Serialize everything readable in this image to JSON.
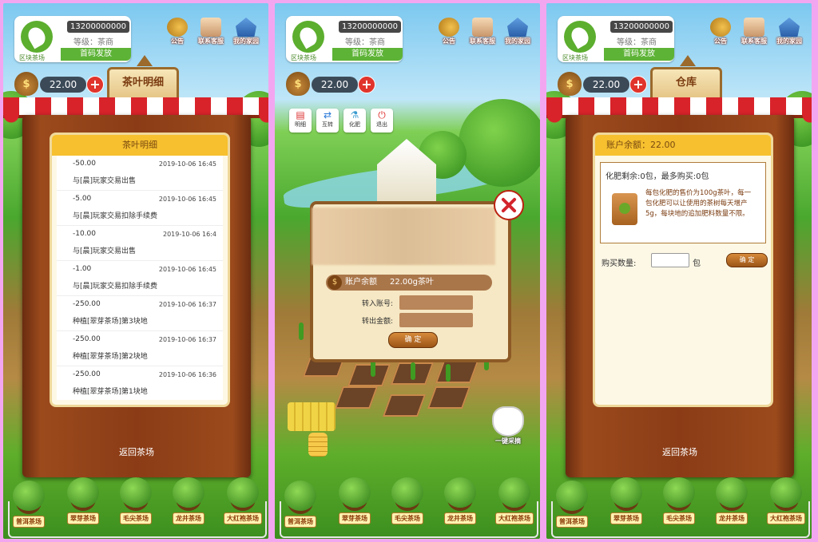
{
  "header": {
    "phone": "13200000000",
    "level_label": "等级：茶商",
    "first_code_label": "首码发放",
    "logo_text": "区块茶场"
  },
  "top_icons": [
    {
      "label": "公告",
      "icon": "speaker-icon"
    },
    {
      "label": "联系客服",
      "icon": "box-icon"
    },
    {
      "label": "我的家园",
      "icon": "house-icon"
    }
  ],
  "balance": "22.00",
  "screen1": {
    "sign": "茶叶明细",
    "panel_title": "茶叶明细",
    "transactions": [
      {
        "amount": "-50.00",
        "time": "2019-10-06 16:45",
        "desc": "与[晨]玩家交易出售"
      },
      {
        "amount": "-5.00",
        "time": "2019-10-06 16:45",
        "desc": "与[晨]玩家交易扣除手续费"
      },
      {
        "amount": "-10.00",
        "time": "2019-10-06 16:4",
        "desc": "与[晨]玩家交易出售"
      },
      {
        "amount": "-1.00",
        "time": "2019-10-06 16:45",
        "desc": "与[晨]玩家交易扣除手续费"
      },
      {
        "amount": "-250.00",
        "time": "2019-10-06 16:37",
        "desc": "种植[翠芽茶场]第3块地"
      },
      {
        "amount": "-250.00",
        "time": "2019-10-06 16:37",
        "desc": "种植[翠芽茶场]第2块地"
      },
      {
        "amount": "-250.00",
        "time": "2019-10-06 16:36",
        "desc": "种植[翠芽茶场]第1块地"
      }
    ],
    "return_label": "返回茶场"
  },
  "screen2": {
    "tools": [
      "明细",
      "互转",
      "化肥",
      "退出"
    ],
    "balance_label": "账户余额",
    "balance_value": "22.00g茶叶",
    "to_account_label": "转入账号:",
    "amount_label": "转出金额:",
    "confirm": "确 定",
    "harvest_label": "一键采摘"
  },
  "screen3": {
    "sign": "仓库",
    "account_balance": "账户余额：22.00",
    "fert_head": "化肥剩余:0包，最多购买:0包",
    "fert_desc": "每包化肥的售价为100g茶叶，每一包化肥可以让使用的茶树每天增产5g，每块地的追加肥料数量不限。",
    "buy_label": "购买数量:",
    "unit": "包",
    "confirm": "确 定",
    "return_label": "返回茶场"
  },
  "farms": [
    "普洱茶场",
    "翠芽茶场",
    "毛尖茶场",
    "龙井茶场",
    "大红袍茶场"
  ]
}
